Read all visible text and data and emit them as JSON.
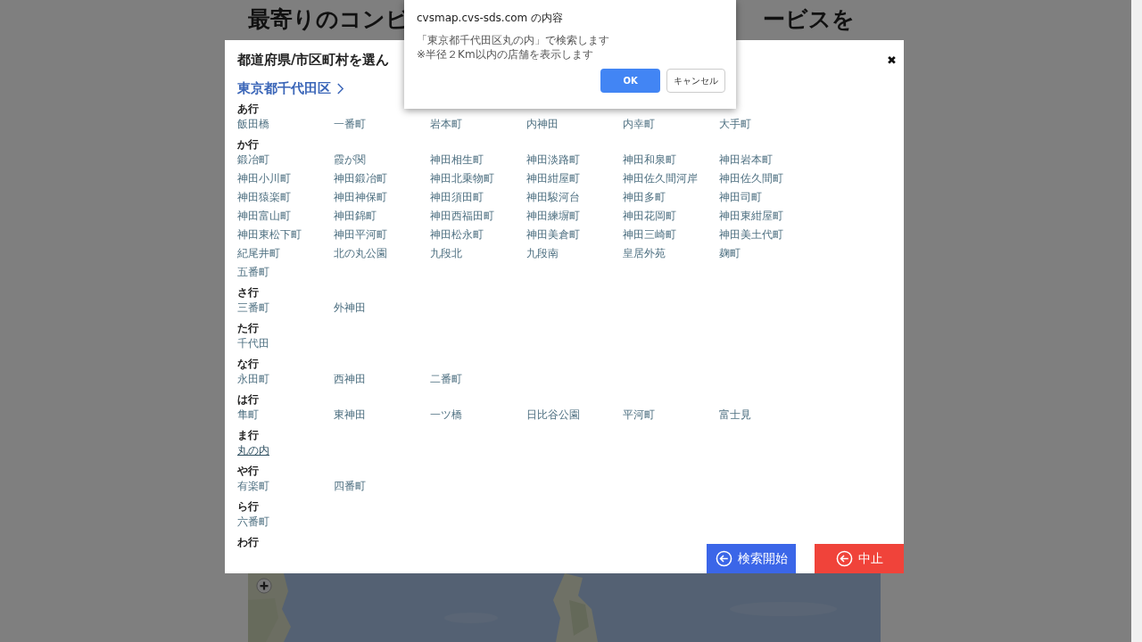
{
  "page": {
    "heading_left": "最寄りのコンビ",
    "heading_right": "ービスを"
  },
  "modal": {
    "title": "都道府県/市区町村を選ん",
    "close": "✖",
    "breadcrumb": "東京都千代田区",
    "sections": [
      {
        "header": "あ行",
        "items": [
          {
            "label": "飯田橋",
            "selected": false
          },
          {
            "label": "一番町",
            "selected": false
          },
          {
            "label": "岩本町",
            "selected": false
          },
          {
            "label": "内神田",
            "selected": false
          },
          {
            "label": "内幸町",
            "selected": false
          },
          {
            "label": "大手町",
            "selected": false
          }
        ]
      },
      {
        "header": "か行",
        "items": [
          {
            "label": "鍛冶町",
            "selected": false
          },
          {
            "label": "霞が関",
            "selected": false
          },
          {
            "label": "神田相生町",
            "selected": false
          },
          {
            "label": "神田淡路町",
            "selected": false
          },
          {
            "label": "神田和泉町",
            "selected": false
          },
          {
            "label": "神田岩本町",
            "selected": false
          },
          {
            "label": "神田小川町",
            "selected": false
          },
          {
            "label": "神田鍛冶町",
            "selected": false
          },
          {
            "label": "神田北乗物町",
            "selected": false
          },
          {
            "label": "神田紺屋町",
            "selected": false
          },
          {
            "label": "神田佐久間河岸",
            "selected": false
          },
          {
            "label": "神田佐久間町",
            "selected": false
          },
          {
            "label": "神田猿楽町",
            "selected": false
          },
          {
            "label": "神田神保町",
            "selected": false
          },
          {
            "label": "神田須田町",
            "selected": false
          },
          {
            "label": "神田駿河台",
            "selected": false
          },
          {
            "label": "神田多町",
            "selected": false
          },
          {
            "label": "神田司町",
            "selected": false
          },
          {
            "label": "神田富山町",
            "selected": false
          },
          {
            "label": "神田錦町",
            "selected": false
          },
          {
            "label": "神田西福田町",
            "selected": false
          },
          {
            "label": "神田練塀町",
            "selected": false
          },
          {
            "label": "神田花岡町",
            "selected": false
          },
          {
            "label": "神田東紺屋町",
            "selected": false
          },
          {
            "label": "神田東松下町",
            "selected": false
          },
          {
            "label": "神田平河町",
            "selected": false
          },
          {
            "label": "神田松永町",
            "selected": false
          },
          {
            "label": "神田美倉町",
            "selected": false
          },
          {
            "label": "神田三崎町",
            "selected": false
          },
          {
            "label": "神田美土代町",
            "selected": false
          },
          {
            "label": "紀尾井町",
            "selected": false
          },
          {
            "label": "北の丸公園",
            "selected": false
          },
          {
            "label": "九段北",
            "selected": false
          },
          {
            "label": "九段南",
            "selected": false
          },
          {
            "label": "皇居外苑",
            "selected": false
          },
          {
            "label": "麹町",
            "selected": false
          },
          {
            "label": "五番町",
            "selected": false
          }
        ]
      },
      {
        "header": "さ行",
        "items": [
          {
            "label": "三番町",
            "selected": false
          },
          {
            "label": "外神田",
            "selected": false
          }
        ]
      },
      {
        "header": "た行",
        "items": [
          {
            "label": "千代田",
            "selected": false
          }
        ]
      },
      {
        "header": "な行",
        "items": [
          {
            "label": "永田町",
            "selected": false
          },
          {
            "label": "西神田",
            "selected": false
          },
          {
            "label": "二番町",
            "selected": false
          }
        ]
      },
      {
        "header": "は行",
        "items": [
          {
            "label": "隼町",
            "selected": false
          },
          {
            "label": "東神田",
            "selected": false
          },
          {
            "label": "一ツ橋",
            "selected": false
          },
          {
            "label": "日比谷公園",
            "selected": false
          },
          {
            "label": "平河町",
            "selected": false
          },
          {
            "label": "富士見",
            "selected": false
          }
        ]
      },
      {
        "header": "ま行",
        "items": [
          {
            "label": "丸の内",
            "selected": true
          }
        ]
      },
      {
        "header": "や行",
        "items": [
          {
            "label": "有楽町",
            "selected": false
          },
          {
            "label": "四番町",
            "selected": false
          }
        ]
      },
      {
        "header": "ら行",
        "items": [
          {
            "label": "六番町",
            "selected": false
          }
        ]
      },
      {
        "header": "わ行"
      }
    ],
    "buttons": [
      {
        "label": "検索開始",
        "kind": "primary"
      },
      {
        "label": "中止",
        "kind": "danger"
      }
    ]
  },
  "alert": {
    "title": "cvsmap.cvs-sds.com の内容",
    "messages": [
      "「東京都千代田区丸の内」で検索します",
      "※半径２Km以内の店舗を表示します"
    ],
    "buttons": [
      {
        "label": "OK",
        "kind": "primary"
      },
      {
        "label": "キャンセル",
        "kind": "secondary"
      }
    ]
  }
}
